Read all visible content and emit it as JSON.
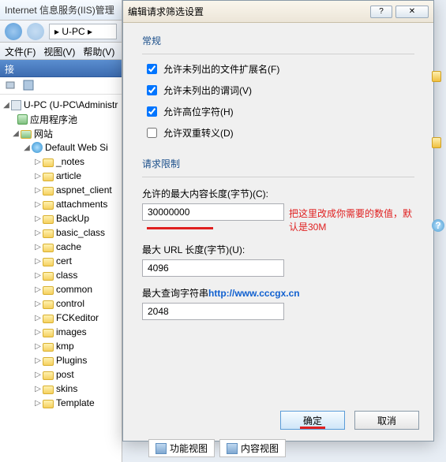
{
  "main": {
    "title": "Internet 信息服务(IIS)管理",
    "location": "U-PC",
    "menu": {
      "file": "文件(F)",
      "view": "视图(V)",
      "help": "帮助(V)"
    },
    "connections": "接"
  },
  "tree": {
    "root": "U-PC (U-PC\\Administr",
    "apppools": "应用程序池",
    "sites": "网站",
    "default_site": "Default Web Si",
    "folders": [
      "_notes",
      "article",
      "aspnet_client",
      "attachments",
      "BackUp",
      "basic_class",
      "cache",
      "cert",
      "class",
      "common",
      "control",
      "FCKeditor",
      "images",
      "kmp",
      "Plugins",
      "post",
      "skins",
      "Template"
    ]
  },
  "dialog": {
    "title": "编辑请求筛选设置",
    "group_general": "常规",
    "chk_ext": "允许未列出的文件扩展名(F)",
    "chk_verbs": "允许未列出的谓词(V)",
    "chk_highbit": "允许高位字符(H)",
    "chk_double": "允许双重转义(D)",
    "group_limits": "请求限制",
    "label_maxcontent": "允许的最大内容长度(字节)(C):",
    "val_maxcontent": "30000000",
    "note_maxcontent": "把这里改成你需要的数值，默认是30M",
    "label_maxurl": "最大 URL 长度(字节)(U):",
    "val_maxurl": "4096",
    "label_maxquery_pre": "最大查询字符串",
    "watermark": "http://www.cccgx.cn",
    "val_maxquery": "2048",
    "ok": "确定",
    "cancel": "取消"
  },
  "bottom": {
    "features": "功能视图",
    "content": "内容视图"
  },
  "help": "?"
}
